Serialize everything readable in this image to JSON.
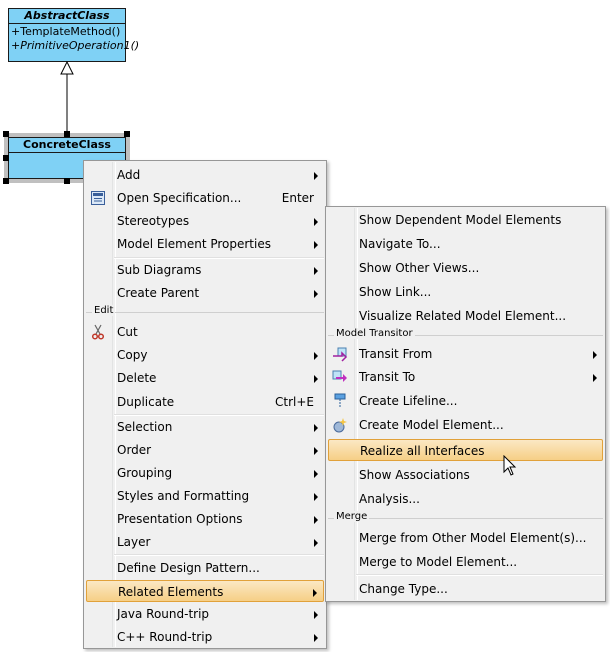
{
  "diagram": {
    "abstract_class": {
      "name": "AbstractClass",
      "operations": [
        "+TemplateMethod()",
        "+PrimitiveOperation1()"
      ]
    },
    "concrete_class": {
      "name": "ConcreteClass"
    }
  },
  "context_menu": {
    "items": [
      {
        "label": "Add",
        "submenu": true
      },
      {
        "label": "Open Specification...",
        "shortcut": "Enter",
        "icon": "specification-icon"
      },
      {
        "label": "Stereotypes",
        "submenu": true
      },
      {
        "label": "Model Element Properties",
        "submenu": true
      },
      {
        "label": "Sub Diagrams",
        "submenu": true
      },
      {
        "label": "Create Parent",
        "submenu": true
      },
      {
        "section": "Edit"
      },
      {
        "label": "Cut",
        "icon": "scissors-icon"
      },
      {
        "label": "Copy",
        "submenu": true
      },
      {
        "label": "Delete",
        "submenu": true
      },
      {
        "label": "Duplicate",
        "shortcut": "Ctrl+E"
      },
      {
        "label": "Selection",
        "submenu": true
      },
      {
        "label": "Order",
        "submenu": true
      },
      {
        "label": "Grouping",
        "submenu": true
      },
      {
        "label": "Styles and Formatting",
        "submenu": true
      },
      {
        "label": "Presentation Options",
        "submenu": true
      },
      {
        "label": "Layer",
        "submenu": true
      },
      {
        "label": "Define Design Pattern..."
      },
      {
        "label": "Related Elements",
        "submenu": true,
        "highlighted": true
      },
      {
        "label": "Java Round-trip",
        "submenu": true
      },
      {
        "label": "C++ Round-trip",
        "submenu": true
      }
    ]
  },
  "submenu": {
    "items": [
      {
        "label": "Show Dependent Model Elements"
      },
      {
        "label": "Navigate To..."
      },
      {
        "label": "Show Other Views..."
      },
      {
        "label": "Show Link..."
      },
      {
        "label": "Visualize Related Model Element..."
      },
      {
        "section": "Model Transitor"
      },
      {
        "label": "Transit From",
        "submenu": true,
        "icon": "transit-from-icon"
      },
      {
        "label": "Transit To",
        "submenu": true,
        "icon": "transit-to-icon"
      },
      {
        "label": "Create Lifeline...",
        "icon": "lifeline-icon"
      },
      {
        "label": "Create Model Element...",
        "icon": "model-element-icon"
      },
      {
        "label": "Realize all Interfaces",
        "highlighted": true
      },
      {
        "label": "Show Associations"
      },
      {
        "label": "Analysis..."
      },
      {
        "section": "Merge"
      },
      {
        "label": "Merge from Other Model Element(s)..."
      },
      {
        "label": "Merge to Model Element..."
      },
      {
        "label": "Change Type..."
      }
    ]
  },
  "colors": {
    "class_fill": "#7fd1f5",
    "menu_bg": "#f0f0f0",
    "highlight": "#f6cf86"
  }
}
